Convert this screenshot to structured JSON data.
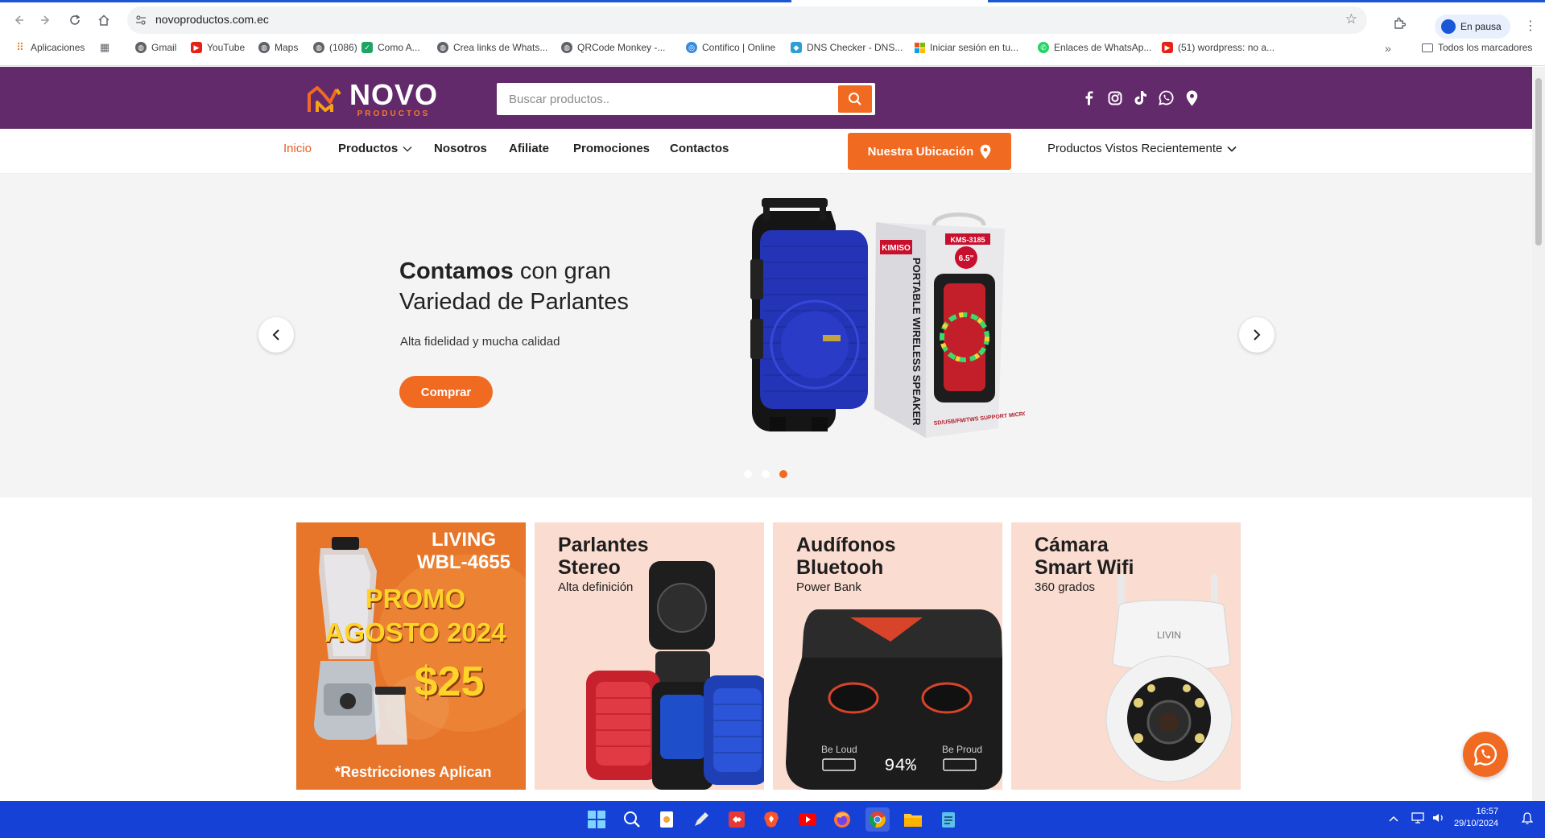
{
  "browser": {
    "url": "novoproductos.com.ec",
    "profile_label": "En pausa",
    "bookmarks": [
      {
        "label": "Aplicaciones"
      },
      {
        "label": "Gmail"
      },
      {
        "label": "YouTube"
      },
      {
        "label": "Maps"
      },
      {
        "label": "(1086)"
      },
      {
        "label": "Como A..."
      },
      {
        "label": "Crea links de Whats..."
      },
      {
        "label": "QRCode Monkey -..."
      },
      {
        "label": "Contifico | Online"
      },
      {
        "label": "DNS Checker - DNS..."
      },
      {
        "label": "Iniciar sesión en tu..."
      },
      {
        "label": "Enlaces de WhatsAp..."
      },
      {
        "label": "(51) wordpress: no a..."
      }
    ],
    "all_bookmarks": "Todos los marcadores"
  },
  "header": {
    "brand_name": "NOVO",
    "brand_sub": "PRODUCTOS",
    "search_placeholder": "Buscar productos..",
    "social_icons": [
      "facebook-icon",
      "instagram-icon",
      "tiktok-icon",
      "whatsapp-icon",
      "map-pin-icon"
    ]
  },
  "nav": {
    "items": [
      "Inicio",
      "Productos",
      "Nosotros",
      "Afiliate",
      "Promociones",
      "Contactos"
    ],
    "location_button": "Nuestra Ubicación",
    "recent_label": "Productos Vistos Recientemente"
  },
  "hero": {
    "title_strong": "Contamos",
    "title_rest_1": " con gran",
    "title_line_2": "Variedad de Parlantes",
    "subtitle": "Alta fidelidad y mucha calidad",
    "button": "Comprar",
    "slide_count": 3,
    "active_slide": 3,
    "speaker_box": {
      "brand": "KIMISO",
      "model": "KMS-3185",
      "size": "6.5\"",
      "side": "PORTABLE WIRELESS SPEAKER",
      "bottom": "SD/USB/FM/TWS SUPPORT MICROPHONE"
    }
  },
  "cards": [
    {
      "type": "promo",
      "line1": "LIVING",
      "line2": "WBL-4655",
      "promo": "PROMO",
      "month": "AGOSTO 2024",
      "price": "$25",
      "note": "*Restricciones Aplican"
    },
    {
      "title_1": "Parlantes",
      "title_2": "Stereo",
      "subtitle": "Alta definición"
    },
    {
      "title_1": "Audífonos",
      "title_2": "Bluetooh",
      "subtitle": "Power Bank",
      "device_left": "Be Loud",
      "device_right": "Be Proud",
      "device_percent": "94%"
    },
    {
      "title_1": "Cámara",
      "title_2": "Smart Wifi",
      "subtitle": "360 grados",
      "camera_brand": "LIVIN"
    }
  ],
  "taskbar": {
    "time": "16:57",
    "date": "29/10/2024"
  },
  "colors": {
    "header_bg": "#632a6b",
    "accent": "#f06a22",
    "card_bg": "#fadcd0",
    "taskbar": "#1541d6"
  }
}
